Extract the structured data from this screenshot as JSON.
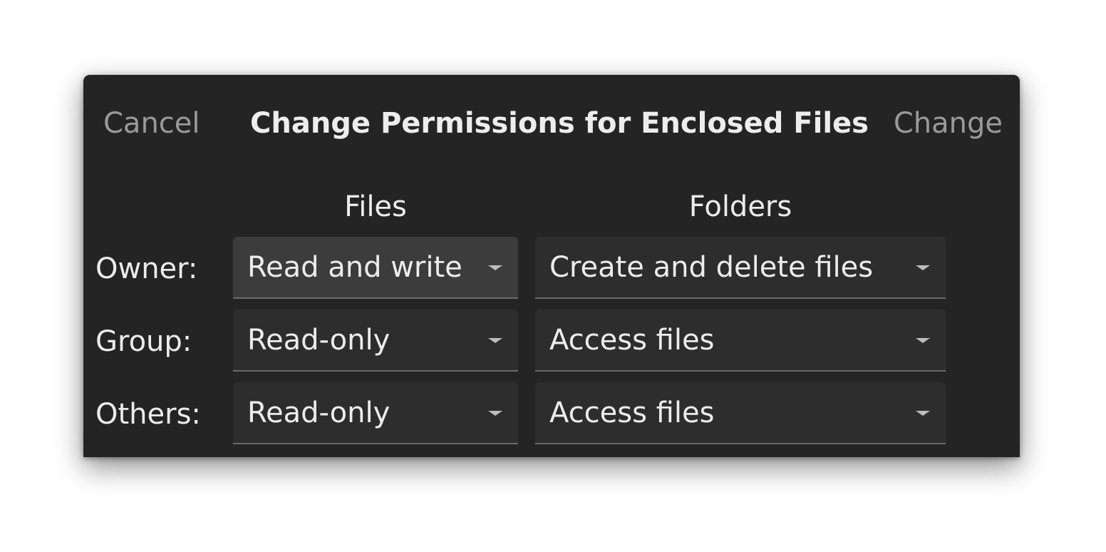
{
  "header": {
    "cancel_label": "Cancel",
    "title": "Change Permissions for Enclosed Files",
    "change_label": "Change"
  },
  "columns": {
    "files": "Files",
    "folders": "Folders"
  },
  "rows": [
    {
      "label": "Owner:",
      "files": "Read and write",
      "folders": "Create and delete files"
    },
    {
      "label": "Group:",
      "files": "Read-only",
      "folders": "Access files"
    },
    {
      "label": "Others:",
      "files": "Read-only",
      "folders": "Access files"
    }
  ],
  "icons": {
    "dropdown_arrow": "chevron-down-icon"
  },
  "colors": {
    "dialog_bg": "#242424",
    "dropdown_bg": "#2d2d2d",
    "dropdown_hover_bg": "#3c3c3c",
    "text": "#ececec",
    "muted_text": "#9a9a9a"
  }
}
